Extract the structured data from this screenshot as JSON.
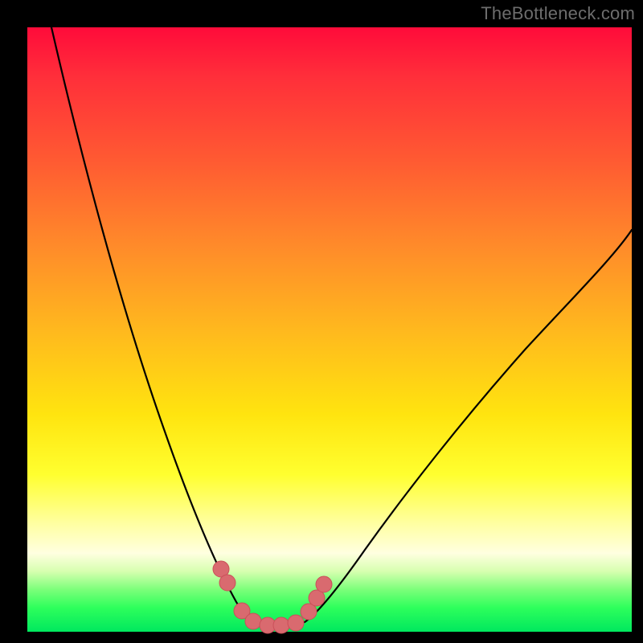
{
  "watermark": {
    "text": "TheBottleneck.com"
  },
  "colors": {
    "frame": "#000000",
    "curve": "#000000",
    "marker_fill": "#d96a6f",
    "marker_stroke": "#c95059",
    "gradient_stops": [
      "#ff0b3a",
      "#ff5a32",
      "#ffb81e",
      "#ffff2f",
      "#ffffe0",
      "#00e85e"
    ]
  },
  "chart_data": {
    "type": "line",
    "title": "",
    "xlabel": "",
    "ylabel": "",
    "xlim": [
      0,
      100
    ],
    "ylim": [
      0,
      100
    ],
    "grid": false,
    "legend": false,
    "note": "Bottleneck-style V-curve. Y is inverted visually: 0 (optimal) at bottom, 100 (max deviation) at top. Values estimated from pixel positions against the 752×752 plot area.",
    "series": [
      {
        "name": "left-branch",
        "x": [
          4.0,
          6.4,
          9.5,
          12.3,
          15.2,
          18.2,
          21.2,
          24.3,
          27.0,
          29.1,
          31.3,
          32.9,
          34.7,
          36.3,
          37.4
        ],
        "y": [
          100.0,
          89.0,
          76.3,
          65.2,
          54.0,
          44.1,
          34.2,
          25.2,
          18.3,
          13.4,
          9.0,
          6.4,
          4.0,
          2.3,
          1.6
        ]
      },
      {
        "name": "right-branch",
        "x": [
          45.9,
          47.9,
          49.9,
          52.0,
          54.5,
          57.6,
          61.6,
          65.9,
          71.0,
          76.6,
          82.6,
          89.1,
          95.7,
          100.0
        ],
        "y": [
          1.7,
          3.1,
          4.8,
          7.0,
          9.8,
          13.8,
          19.0,
          24.6,
          31.1,
          38.0,
          45.5,
          53.5,
          61.4,
          66.5
        ]
      },
      {
        "name": "trough-flat",
        "x": [
          37.4,
          39.0,
          41.5,
          43.5,
          45.9
        ],
        "y": [
          1.6,
          1.1,
          1.0,
          1.1,
          1.7
        ]
      }
    ],
    "markers": {
      "name": "salient-points",
      "points": [
        {
          "x": 32.0,
          "y": 10.4
        },
        {
          "x": 33.1,
          "y": 8.1
        },
        {
          "x": 35.5,
          "y": 3.5
        },
        {
          "x": 37.4,
          "y": 1.7
        },
        {
          "x": 39.8,
          "y": 1.1
        },
        {
          "x": 42.0,
          "y": 1.1
        },
        {
          "x": 44.4,
          "y": 1.5
        },
        {
          "x": 46.5,
          "y": 3.3
        },
        {
          "x": 47.9,
          "y": 5.6
        },
        {
          "x": 49.1,
          "y": 7.8
        }
      ],
      "radius_px": 10
    }
  }
}
